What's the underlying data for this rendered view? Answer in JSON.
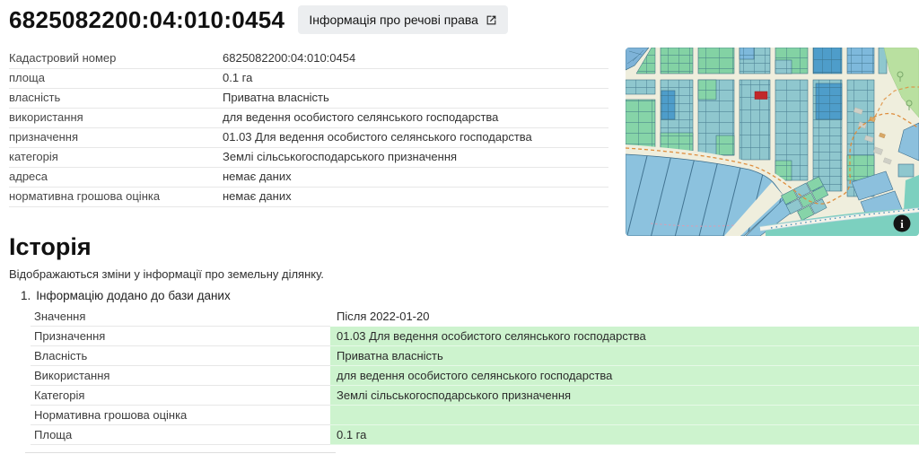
{
  "header": {
    "title": "6825082200:04:010:0454",
    "rights_button_label": "Інформація про речові права",
    "rights_button_icon": "external-link-icon"
  },
  "details_table": {
    "rows": [
      {
        "label": "Кадастровий номер",
        "value": "6825082200:04:010:0454"
      },
      {
        "label": "площа",
        "value": "0.1 га"
      },
      {
        "label": "власність",
        "value": "Приватна власність"
      },
      {
        "label": "використання",
        "value": "для ведення особистого селянського господарства"
      },
      {
        "label": "призначення",
        "value": "01.03 Для ведення особистого селянського господарства"
      },
      {
        "label": "категорія",
        "value": "Землі сільськогосподарського призначення"
      },
      {
        "label": "адреса",
        "value": "немає даних"
      },
      {
        "label": "нормативна грошова оцінка",
        "value": "немає даних"
      }
    ]
  },
  "map": {
    "type": "cadastral-parcels-map",
    "selected_parcel_color": "#c2282a",
    "info_icon": "info-icon"
  },
  "history": {
    "heading": "Історія",
    "description": "Відображаються зміни у інформації про земельну ділянку.",
    "highlight_color": "#cdf3ce",
    "entries": [
      {
        "index": "1.",
        "title": "Інформацію додано до бази даних",
        "table": {
          "header": {
            "label": "Значення",
            "value": "Після 2022-01-20"
          },
          "rows": [
            {
              "label": "Призначення",
              "value": "01.03 Для ведення особистого селянського господарства"
            },
            {
              "label": "Власність",
              "value": "Приватна власність"
            },
            {
              "label": "Використання",
              "value": "для ведення особистого селянського господарства"
            },
            {
              "label": "Категорія",
              "value": "Землі сільськогосподарського призначення"
            },
            {
              "label": "Нормативна грошова оцінка",
              "value": ""
            },
            {
              "label": "Площа",
              "value": "0.1 га"
            }
          ]
        }
      }
    ]
  }
}
